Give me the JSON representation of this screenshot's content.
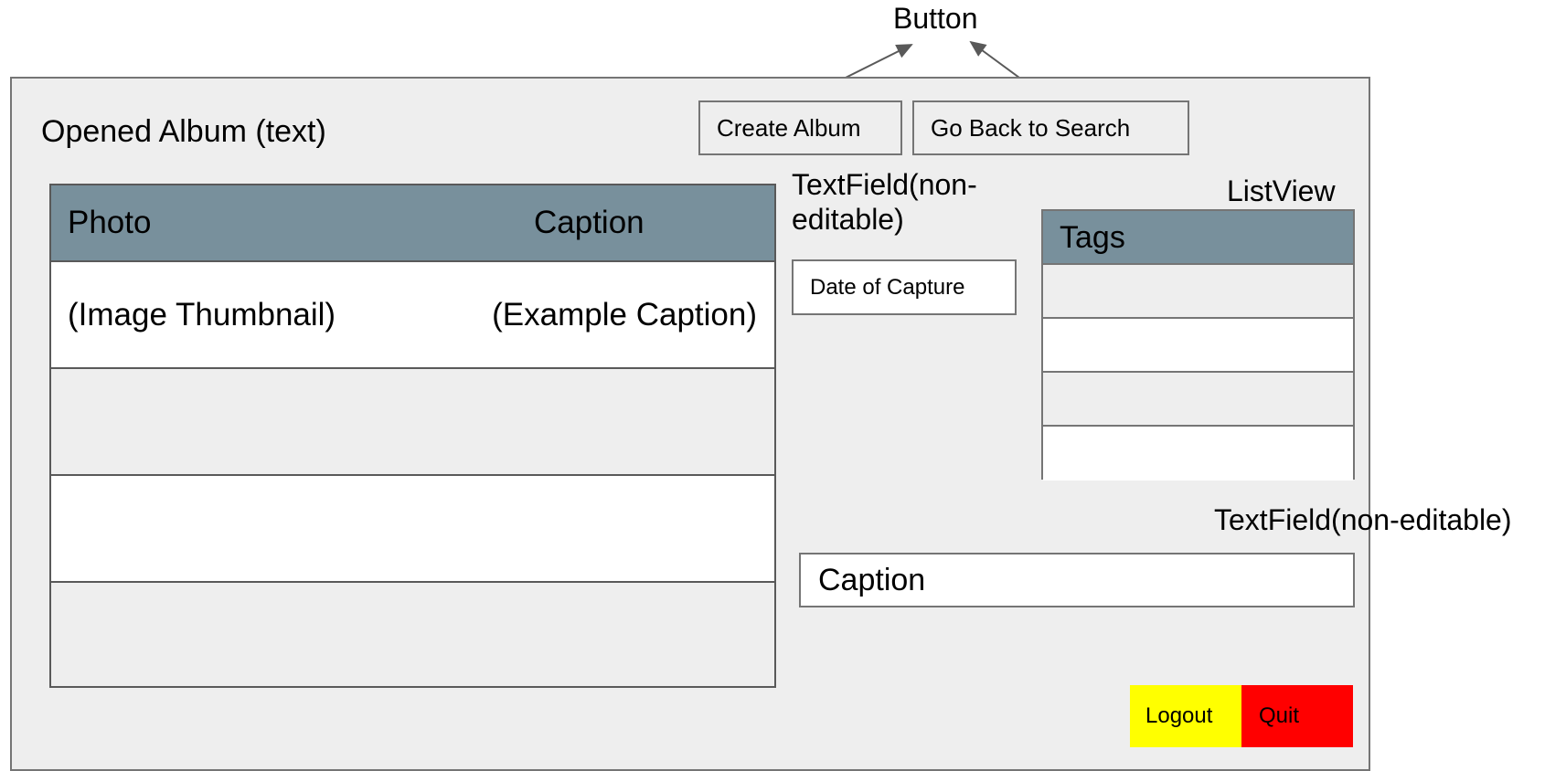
{
  "annotations": {
    "button_label": "Button",
    "textfield_date_label": "TextField(non-\neditable)",
    "listview_label": "ListView",
    "textfield_caption_label": "TextField(non-editable)"
  },
  "album": {
    "title": "Opened Album (text)"
  },
  "toolbar": {
    "create_album": "Create Album",
    "go_back": "Go Back to Search"
  },
  "photo_table": {
    "columns": [
      "Photo",
      "Caption"
    ],
    "rows": [
      {
        "photo": "(Image Thumbnail)",
        "caption": "(Example Caption)"
      },
      {
        "photo": "",
        "caption": ""
      },
      {
        "photo": "",
        "caption": ""
      },
      {
        "photo": "",
        "caption": ""
      }
    ]
  },
  "date_field": {
    "value": "Date of Capture"
  },
  "tags_list": {
    "header": "Tags",
    "items": [
      "",
      "",
      "",
      ""
    ]
  },
  "caption_field": {
    "value": "Caption"
  },
  "footer": {
    "logout": "Logout",
    "quit": "Quit"
  },
  "colors": {
    "frame_bg": "#eeeeee",
    "header_bg": "#78909c",
    "logout_bg": "#ffff00",
    "quit_bg": "#ff0000"
  }
}
